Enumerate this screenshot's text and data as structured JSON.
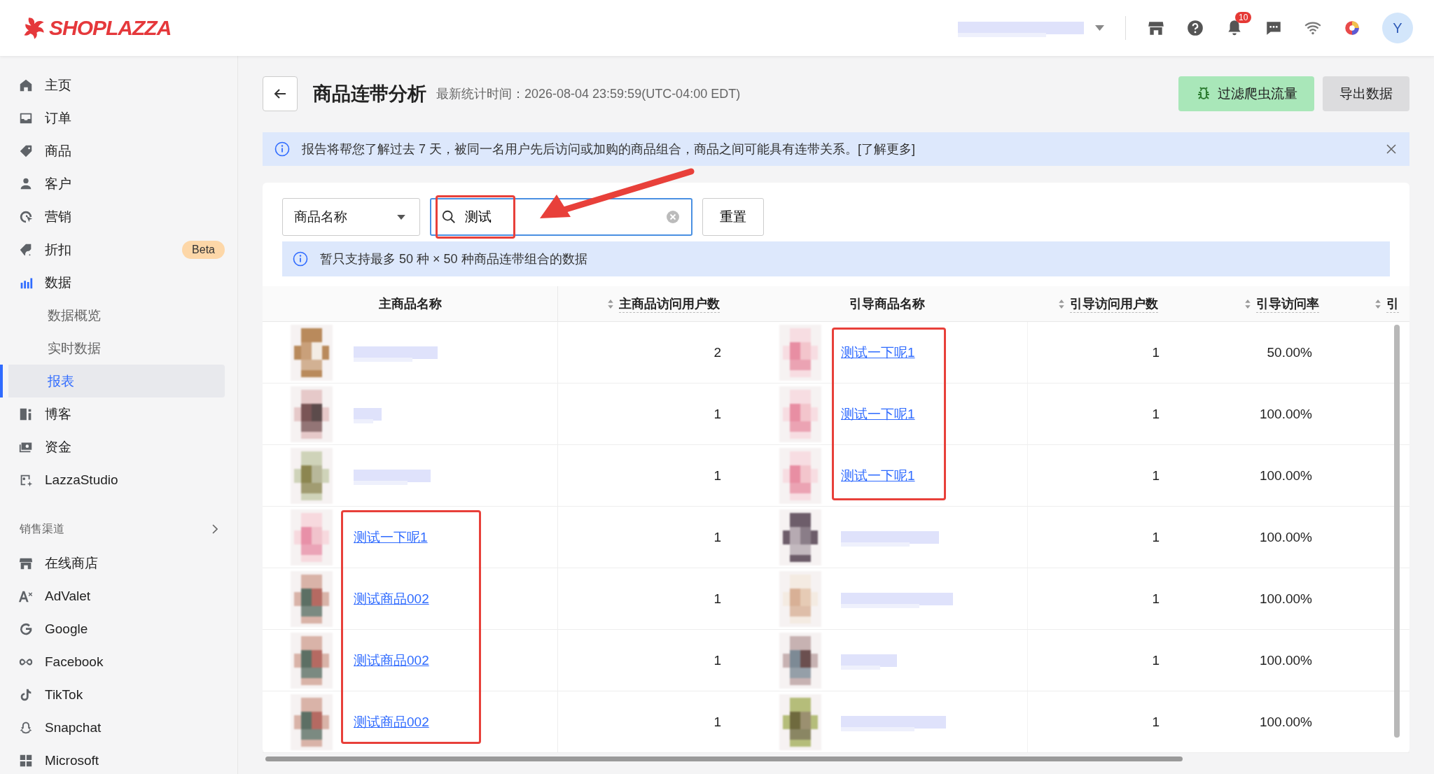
{
  "topbar": {
    "logo": "SHOPLAZZA",
    "notification_count": "10",
    "avatar": "Y"
  },
  "sidebar": {
    "items": [
      {
        "label": "主页",
        "selected": false
      },
      {
        "label": "订单",
        "selected": false
      },
      {
        "label": "商品",
        "selected": false
      },
      {
        "label": "客户",
        "selected": false
      },
      {
        "label": "营销",
        "selected": false
      },
      {
        "label": "折扣",
        "selected": false,
        "badge": "Beta"
      },
      {
        "label": "数据",
        "selected": false,
        "children": [
          {
            "label": "数据概览",
            "selected": false
          },
          {
            "label": "实时数据",
            "selected": false
          },
          {
            "label": "报表",
            "selected": true
          }
        ]
      },
      {
        "label": "博客",
        "selected": false
      },
      {
        "label": "资金",
        "selected": false
      },
      {
        "label": "LazzaStudio",
        "selected": false
      }
    ],
    "section": "销售渠道",
    "channels": [
      {
        "label": "在线商店",
        "selected": false
      },
      {
        "label": "AdValet",
        "selected": false
      },
      {
        "label": "Google",
        "selected": false
      },
      {
        "label": "Facebook",
        "selected": false
      },
      {
        "label": "TikTok",
        "selected": false
      },
      {
        "label": "Snapchat",
        "selected": false
      },
      {
        "label": "Microsoft",
        "selected": false
      }
    ]
  },
  "page": {
    "title": "商品连带分析",
    "updated": "最新统计时间：2026-08-04 23:59:59(UTC-04:00 EDT)",
    "buttons": [
      {
        "label": "过滤爬虫流量",
        "kind": "filter"
      },
      {
        "label": "导出数据",
        "kind": "export"
      }
    ]
  },
  "notice": {
    "text": "报告将帮您了解过去 7 天，被同一名用户先后访问或加购的商品组合，商品之间可能具有连带关系。",
    "link": "[了解更多]"
  },
  "filter": {
    "field": "商品名称",
    "search": {
      "value": "测试",
      "highlighted": true
    },
    "reset": "重置",
    "arrow_annotation": true
  },
  "limit_note": "暂只支持最多 50 种 × 50 种商品连带组合的数据",
  "table": {
    "columns": [
      {
        "label": "主商品名称",
        "sortable": false
      },
      {
        "label": "主商品访问用户数",
        "sortable": true
      },
      {
        "label": "引导商品名称",
        "sortable": false
      },
      {
        "label": "引导访问用户数",
        "sortable": true
      },
      {
        "label": "引导访问率",
        "sortable": true
      },
      {
        "label": "引",
        "sortable": true
      }
    ],
    "rows": [
      {
        "main_name": {
          "kind": "redacted"
        },
        "main_visitors": "2",
        "guide_name": {
          "kind": "link",
          "text": "测试一下呢1"
        },
        "guide_visitors": "1",
        "rate": "50.00%",
        "main_highlighted": false,
        "guide_highlighted": true
      },
      {
        "main_name": {
          "kind": "redacted"
        },
        "main_visitors": "1",
        "guide_name": {
          "kind": "link",
          "text": "测试一下呢1"
        },
        "guide_visitors": "1",
        "rate": "100.00%",
        "main_highlighted": false,
        "guide_highlighted": true
      },
      {
        "main_name": {
          "kind": "redacted"
        },
        "main_visitors": "1",
        "guide_name": {
          "kind": "link",
          "text": "测试一下呢1"
        },
        "guide_visitors": "1",
        "rate": "100.00%",
        "main_highlighted": false,
        "guide_highlighted": true
      },
      {
        "main_name": {
          "kind": "link",
          "text": "测试一下呢1"
        },
        "main_visitors": "1",
        "guide_name": {
          "kind": "redacted"
        },
        "guide_visitors": "1",
        "rate": "100.00%",
        "main_highlighted": true,
        "guide_highlighted": false
      },
      {
        "main_name": {
          "kind": "link",
          "text": "测试商品002"
        },
        "main_visitors": "1",
        "guide_name": {
          "kind": "redacted"
        },
        "guide_visitors": "1",
        "rate": "100.00%",
        "main_highlighted": true,
        "guide_highlighted": false
      },
      {
        "main_name": {
          "kind": "link",
          "text": "测试商品002"
        },
        "main_visitors": "1",
        "guide_name": {
          "kind": "redacted"
        },
        "guide_visitors": "1",
        "rate": "100.00%",
        "main_highlighted": true,
        "guide_highlighted": false
      },
      {
        "main_name": {
          "kind": "link",
          "text": "测试商品002"
        },
        "main_visitors": "1",
        "guide_name": {
          "kind": "redacted"
        },
        "guide_visitors": "1",
        "rate": "100.00%",
        "main_highlighted": true,
        "guide_highlighted": false
      }
    ]
  }
}
